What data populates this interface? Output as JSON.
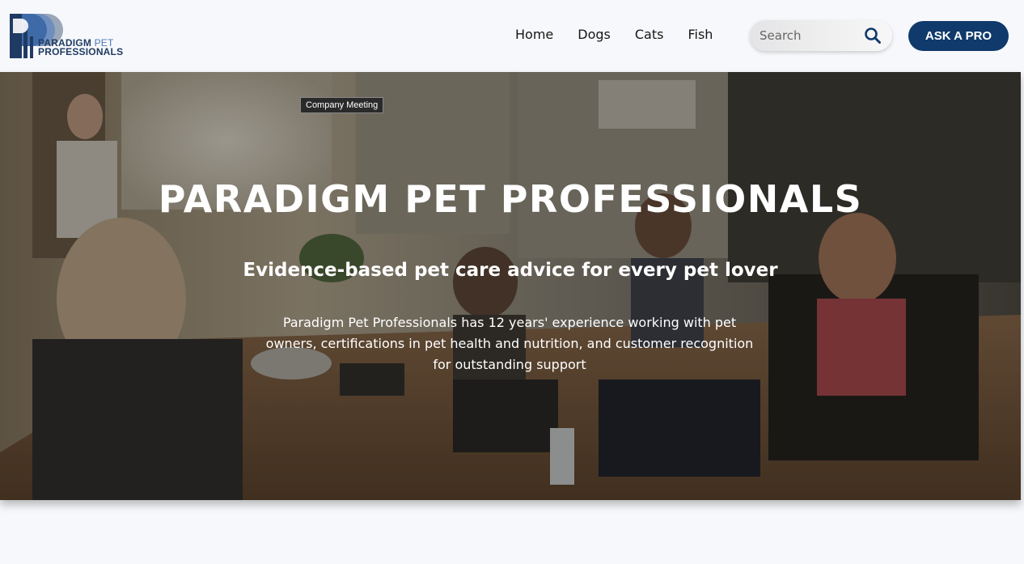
{
  "header": {
    "logo": {
      "line1_main": "PARADIGM",
      "line1_accent": " PET",
      "line2": "PROFESSIONALS"
    },
    "nav": [
      {
        "label": "Home"
      },
      {
        "label": "Dogs"
      },
      {
        "label": "Cats"
      },
      {
        "label": "Fish"
      }
    ],
    "search": {
      "placeholder": "Search",
      "icon": "search-icon"
    },
    "cta_label": "ASK A PRO"
  },
  "hero": {
    "image_tooltip": "Company Meeting",
    "title": "PARADIGM PET PROFESSIONALS",
    "subtitle": "Evidence-based pet care advice for every pet lover",
    "description": "Paradigm Pet Professionals has 12 years' experience working with pet owners, certifications in pet health and nutrition, and customer recognition for outstanding support"
  },
  "colors": {
    "brand_navy": "#0f3a6b",
    "logo_blue": "#4a79b9",
    "page_bg": "#f7f8fb"
  }
}
